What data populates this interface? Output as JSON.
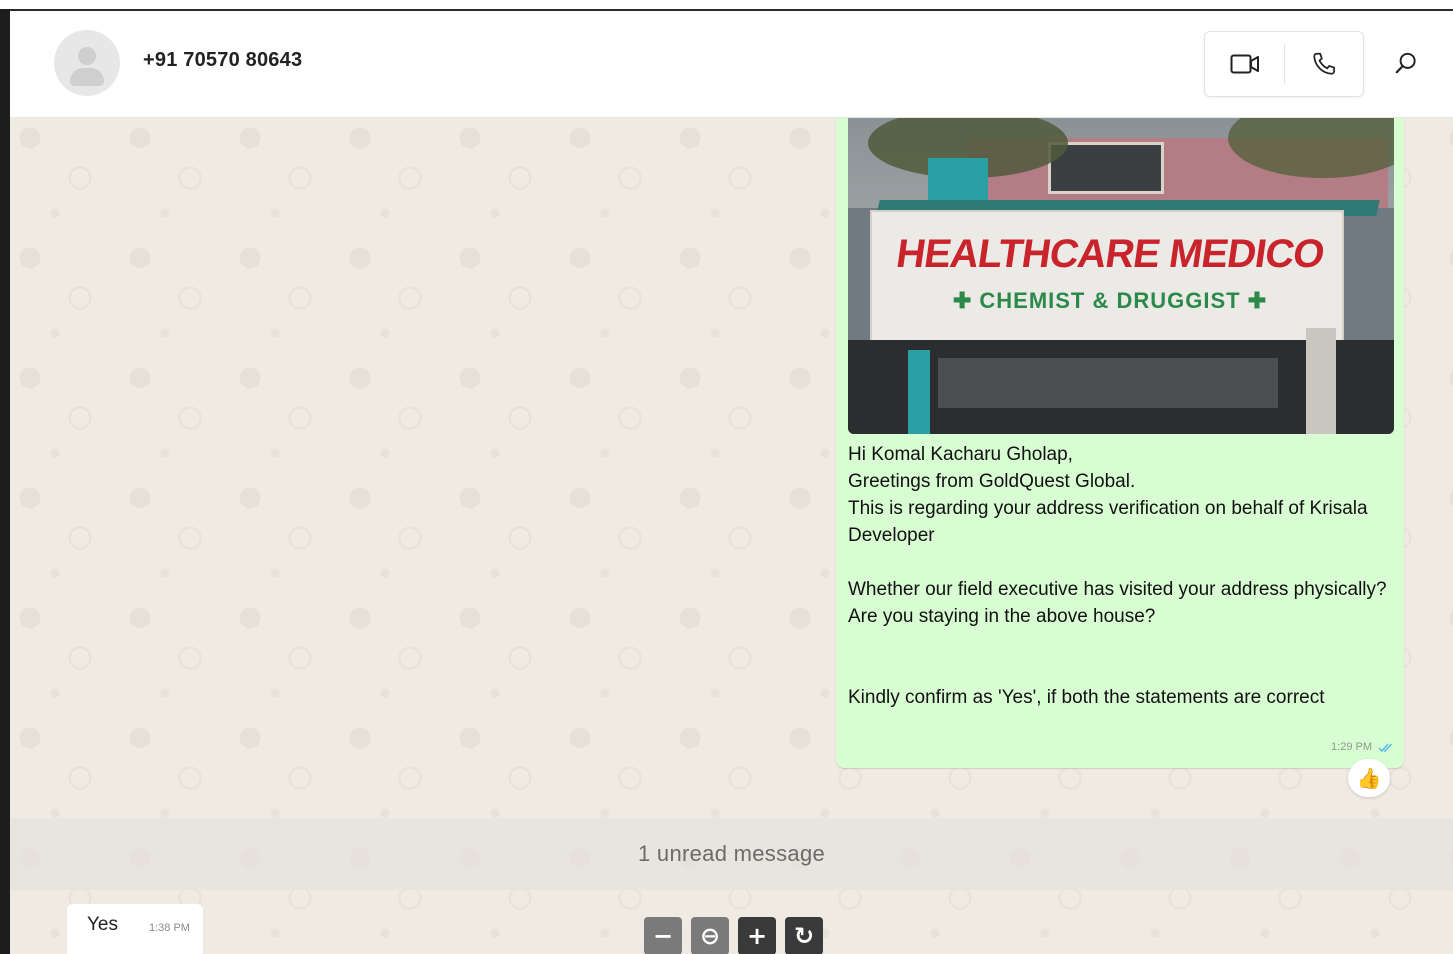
{
  "header": {
    "contact_name": "+91 70570 80643",
    "icons": {
      "video": "video-camera-icon",
      "phone": "phone-icon",
      "search": "search-icon"
    }
  },
  "messages": {
    "outgoing": {
      "image": {
        "sign_main": "HEALTHCARE MEDICO",
        "sign_sub": "✚ CHEMIST & DRUGGIST ✚"
      },
      "text": "Hi Komal Kacharu Gholap,\nGreetings from GoldQuest Global.\nThis is regarding your address verification on behalf of Krisala Developer\n\nWhether our field executive has visited your address physically?\nAre you staying in the above house?\n\n\nKindly confirm as 'Yes', if both the statements are correct",
      "time": "1:29 PM",
      "status_icon": "double-check-icon",
      "reaction": "👍"
    },
    "unread_banner": "1 unread message",
    "incoming": {
      "text": "Yes",
      "time": "1:38 PM"
    }
  },
  "zoom_controls": {
    "minus": "−",
    "zoom_out": "⊖",
    "plus": "+",
    "reset": "↻"
  },
  "colors": {
    "outgoing_bubble": "#d9fdd3",
    "chat_background": "#efeae2",
    "read_tick": "#53bdeb"
  }
}
